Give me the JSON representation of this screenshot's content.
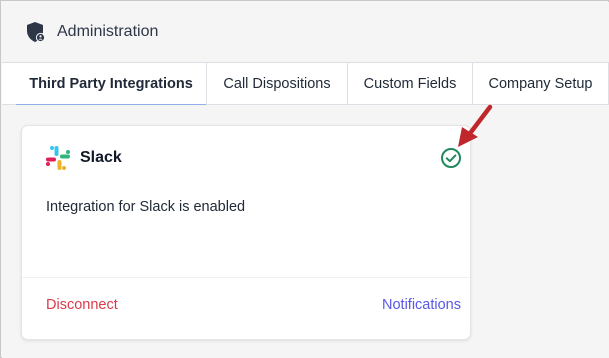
{
  "header": {
    "title": "Administration",
    "icon": "shield-icon"
  },
  "tabs": [
    {
      "label": "Third Party Integrations",
      "active": true
    },
    {
      "label": "Call Dispositions",
      "active": false
    },
    {
      "label": "Custom Fields",
      "active": false
    },
    {
      "label": "Company Setup",
      "active": false
    }
  ],
  "card": {
    "name": "Slack",
    "logo": "slack-logo-icon",
    "status_icon": "check-circle-icon",
    "description": "Integration for Slack is enabled",
    "disconnect_label": "Disconnect",
    "notifications_label": "Notifications"
  },
  "colors": {
    "accent_tab": "#8fb0e8",
    "disconnect": "#d93b4a",
    "notifications": "#5a57e6",
    "check": "#1f8a5c",
    "annotation_arrow": "#c0272d"
  },
  "annotation": {
    "icon": "red-arrow-icon"
  }
}
